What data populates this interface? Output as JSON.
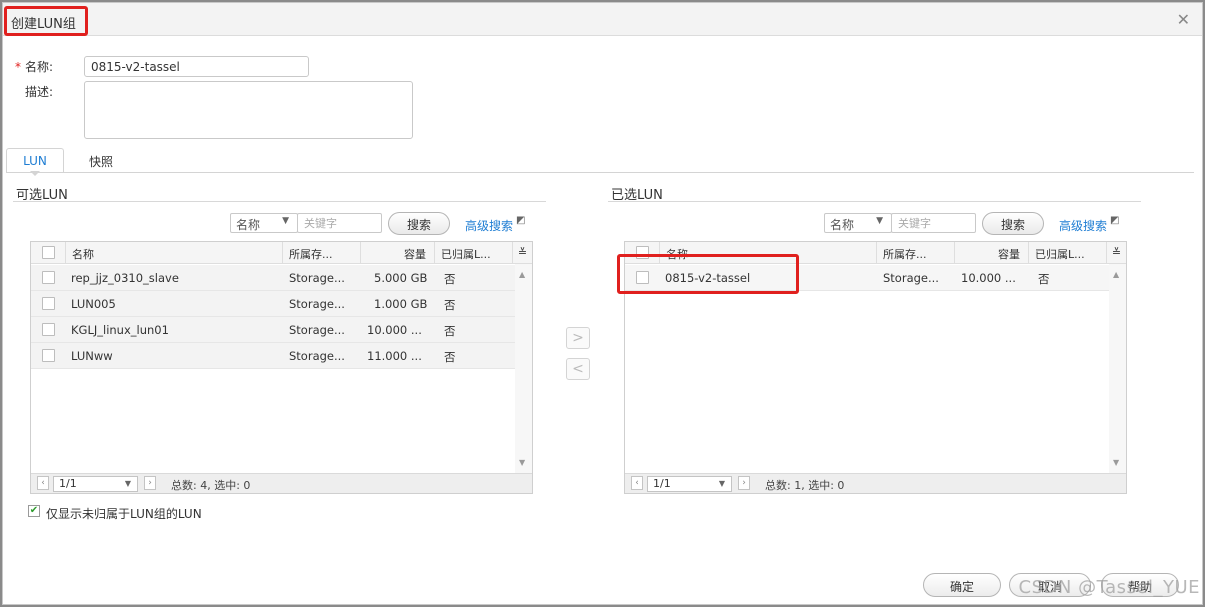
{
  "dialog": {
    "title": "创建LUN组",
    "close_glyph": "✕"
  },
  "form": {
    "required_mark": "*",
    "name_label": "名称:",
    "name_value": "0815-v2-tassel",
    "desc_label": "描述:",
    "desc_value": ""
  },
  "tabs": [
    {
      "label": "LUN",
      "active": true
    },
    {
      "label": "快照",
      "active": false
    }
  ],
  "available": {
    "section_title": "可选LUN",
    "filter_field": "名称",
    "keyword_placeholder": "关键字",
    "search_label": "搜索",
    "advanced_search_label": "高级搜索",
    "columns": [
      "名称",
      "所属存...",
      "容量",
      "已归属L..."
    ],
    "rows": [
      {
        "name": "rep_jjz_0310_slave",
        "storage": "Storage...",
        "capacity": "5.000 GB",
        "belongs": "否"
      },
      {
        "name": "LUN005",
        "storage": "Storage...",
        "capacity": "1.000 GB",
        "belongs": "否"
      },
      {
        "name": "KGLJ_linux_lun01",
        "storage": "Storage...",
        "capacity": "10.000 ...",
        "belongs": "否"
      },
      {
        "name": "LUNww",
        "storage": "Storage...",
        "capacity": "11.000 ...",
        "belongs": "否"
      }
    ],
    "page": "1/1",
    "summary": "总数: 4, 选中: 0"
  },
  "selected": {
    "section_title": "已选LUN",
    "filter_field": "名称",
    "keyword_placeholder": "关键字",
    "search_label": "搜索",
    "advanced_search_label": "高级搜索",
    "columns": [
      "名称",
      "所属存...",
      "容量",
      "已归属L..."
    ],
    "rows": [
      {
        "name": "0815-v2-tassel",
        "storage": "Storage...",
        "capacity": "10.000 ...",
        "belongs": "否"
      }
    ],
    "page": "1/1",
    "summary": "总数: 1, 选中: 0"
  },
  "move": {
    "add_glyph": ">",
    "remove_glyph": "<"
  },
  "option": {
    "checked": true,
    "label": "仅显示未归属于LUN组的LUN"
  },
  "footer": {
    "ok_label": "确定",
    "cancel_label": "取消",
    "help_label": "帮助"
  },
  "watermark": "CSDN @Tassel_YUE",
  "colors": {
    "accent": "#1e7dd3",
    "highlight_red": "#e0201e"
  }
}
